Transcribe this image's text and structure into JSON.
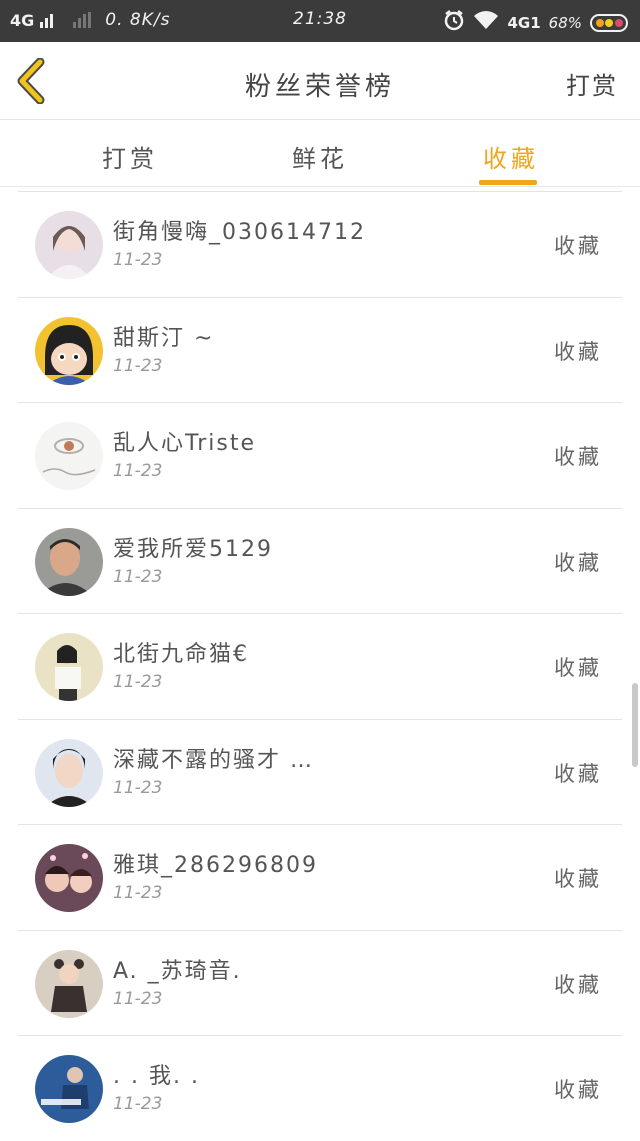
{
  "status_bar": {
    "network": "4G",
    "speed": "0. 8K/s",
    "time": "21:38",
    "network_right": "4G1",
    "battery": "68%"
  },
  "header": {
    "title": "粉丝荣誉榜",
    "right_action": "打赏"
  },
  "tabs": [
    {
      "label": "打赏",
      "active": false
    },
    {
      "label": "鲜花",
      "active": false
    },
    {
      "label": "收藏",
      "active": true
    }
  ],
  "accent_color": "#f0a51e",
  "list": [
    {
      "name": "街角慢嗨_030614712",
      "date": "11-23",
      "action": "收藏"
    },
    {
      "name": "甜斯汀 ~",
      "date": "11-23",
      "action": "收藏"
    },
    {
      "name": "乱人心Triste",
      "date": "11-23",
      "action": "收藏"
    },
    {
      "name": "爱我所爱5129",
      "date": "11-23",
      "action": "收藏"
    },
    {
      "name": "北街九命猫€",
      "date": "11-23",
      "action": "收藏"
    },
    {
      "name": "深藏不露的骚才 …",
      "date": "11-23",
      "action": "收藏"
    },
    {
      "name": "雅琪_286296809",
      "date": "11-23",
      "action": "收藏"
    },
    {
      "name": "A. _苏琦音.",
      "date": "11-23",
      "action": "收藏"
    },
    {
      "name": ". . 我. .",
      "date": "11-23",
      "action": "收藏"
    }
  ]
}
